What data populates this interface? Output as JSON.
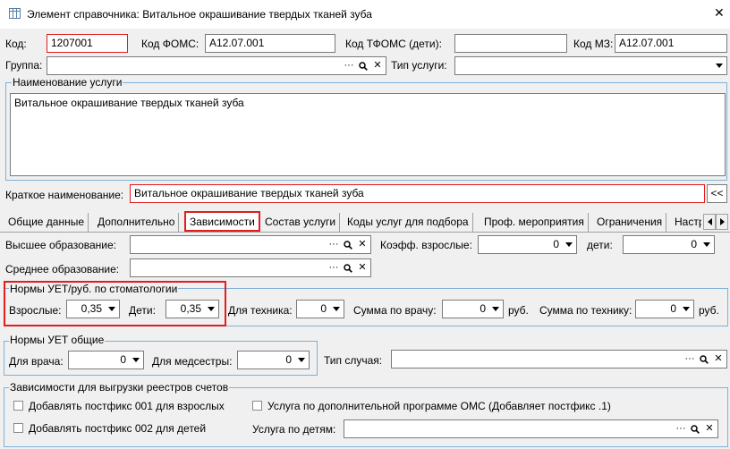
{
  "window": {
    "title": "Элемент справочника: Витальное окрашивание твердых тканей зуба",
    "close_glyph": "✕"
  },
  "fields": {
    "code_label": "Код:",
    "code_value": "1207001",
    "foms_label": "Код ФОМС:",
    "foms_value": "A12.07.001",
    "tfoms_label": "Код ТФОМС (дети):",
    "tfoms_value": "",
    "mz_label": "Код МЗ:",
    "mz_value": "A12.07.001",
    "group_label": "Группа:",
    "group_value": "",
    "service_type_label": "Тип услуги:",
    "service_type_value": "",
    "name_group_title": "Наименование услуги",
    "name_value": "Витальное окрашивание твердых тканей зуба",
    "short_name_label": "Краткое наименование:",
    "short_name_value": "Витальное окрашивание твердых тканей зуба",
    "short_name_btn": "<<"
  },
  "tabs": [
    {
      "label": "Общие данные"
    },
    {
      "label": "Дополнительно"
    },
    {
      "label": "Зависимости"
    },
    {
      "label": "Состав услуги"
    },
    {
      "label": "Коды услуг для подбора"
    },
    {
      "label": "Проф. мероприятия"
    },
    {
      "label": "Ограничения"
    },
    {
      "label": "Настр"
    }
  ],
  "deps": {
    "higher_edu_label": "Высшее образование:",
    "higher_edu_value": "",
    "secondary_edu_label": "Среднее образование:",
    "secondary_edu_value": "",
    "coef_adults_label": "Коэфф. взрослые:",
    "coef_adults_value": "0",
    "children_label": "дети:",
    "children_value": "0",
    "stomat_group_title": "Нормы УЕТ/руб. по стоматологии",
    "adults_label": "Взрослые:",
    "adults_value": "0,35",
    "kids_label": "Дети:",
    "kids_value": "0,35",
    "tech_label": "Для техника:",
    "tech_value": "0",
    "sum_doctor_label": "Сумма по врачу:",
    "sum_doctor_value": "0",
    "rub1": "руб.",
    "sum_tech_label": "Сумма по технику:",
    "sum_tech_value": "0",
    "rub2": "руб.",
    "uet_group_title": "Нормы УЕТ общие",
    "for_doctor_label": "Для врача:",
    "for_doctor_value": "0",
    "for_nurse_label": "Для медсестры:",
    "for_nurse_value": "0",
    "case_type_label": "Тип случая:",
    "case_type_value": "",
    "export_group_title": "Зависимости для выгрузки реестров счетов",
    "postfix001_label": "Добавлять постфикс 001 для взрослых",
    "postfix002_label": "Добавлять постфикс 002 для детей",
    "additional_program_label": "Услуга по дополнительной программе ОМС (Добавляет постфикс .1)",
    "kids_service_label": "Услуга по детям:",
    "kids_service_value": ""
  },
  "icons": {
    "ellipsis": "···",
    "clear": "✕"
  },
  "colors": {
    "highlight_red": "#e31c1c",
    "group_border": "#7fb0d8"
  }
}
